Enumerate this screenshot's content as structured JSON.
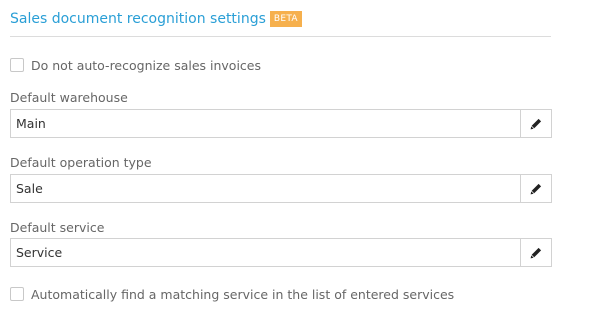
{
  "section": {
    "title": "Sales document recognition settings",
    "badge": "BETA"
  },
  "options": {
    "no_auto_recognize": {
      "label": "Do not auto-recognize sales invoices",
      "checked": false
    },
    "auto_find_service": {
      "label": "Automatically find a matching service in the list of entered services",
      "checked": false
    }
  },
  "fields": {
    "warehouse": {
      "label": "Default warehouse",
      "value": "Main"
    },
    "operation_type": {
      "label": "Default operation type",
      "value": "Sale"
    },
    "service": {
      "label": "Default service",
      "value": "Service"
    }
  },
  "icons": {
    "edit": "pencil-icon",
    "checkbox": "checkbox-unchecked-icon"
  },
  "colors": {
    "title": "#2a9fd6",
    "badge_bg": "#f6b04d",
    "border": "#d2d2d2"
  }
}
